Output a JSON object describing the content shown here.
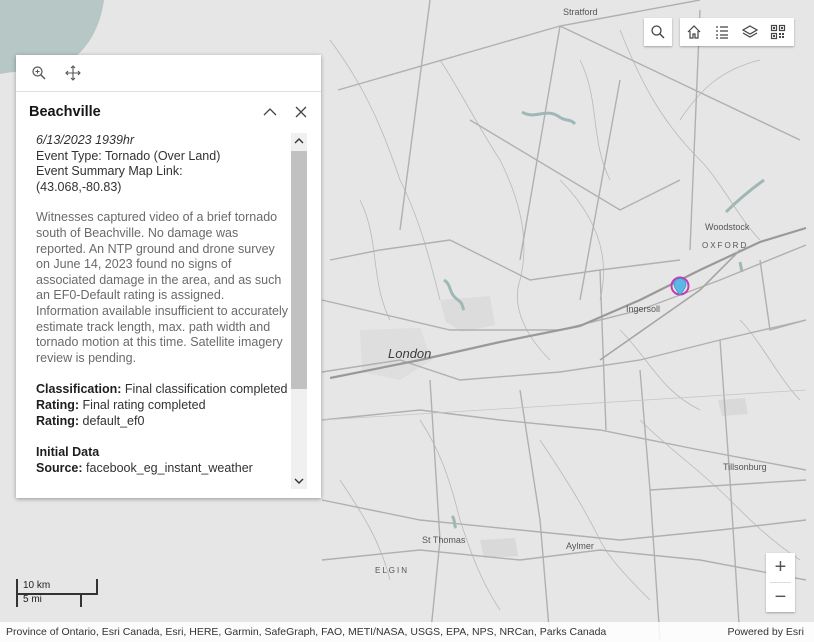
{
  "map": {
    "place_labels": {
      "stratford": "Stratford",
      "woodstock": "Woodstock",
      "oxford": "OXFORD",
      "ingersoll": "Ingersoll",
      "london": "London",
      "tillsonburg": "Tillsonburg",
      "st_thomas": "St Thomas",
      "aylmer": "Aylmer",
      "elgin": "ELGIN"
    },
    "water_color": "#b6c7c6",
    "land_color": "#e6e6e6",
    "road_color": "#b5b5b5"
  },
  "toolbar": {
    "icons": [
      "search-icon",
      "home-icon",
      "legend-icon",
      "layers-icon",
      "qr-code-icon"
    ]
  },
  "popup": {
    "action_icons": [
      "zoom-to-icon",
      "pan-icon"
    ],
    "title": "Beachville",
    "date": "6/13/2023 1939hr",
    "event_type": "Event Type: Tornado (Over Land)",
    "map_link_label": "Event Summary Map Link:",
    "coords": "(43.068,-80.83)",
    "description": "Witnesses captured video of a brief tornado south of Beachville. No damage was reported. An NTP ground and drone survey on June 14, 2023 found no signs of associated damage in the area, and as such an EF0-Default rating is assigned. Information available insufficient to accurately estimate track length, max. path width and tornado motion at this time. Satellite imagery review is pending.",
    "classification_label": "Classification:",
    "classification_value": "Final classification completed",
    "rating_text_label": "Rating:",
    "rating_text_value": "Final rating completed",
    "rating_label": "Rating:",
    "rating_value": "default_ef0",
    "initial_data_heading": "Initial Data",
    "source_label": "Source:",
    "source_value": "facebook_eg_instant_weather"
  },
  "marker": {
    "color": "#5bb8e6",
    "ring_color": "#c23bb4"
  },
  "scalebar": {
    "metric": "10 km",
    "imperial": "5 mi"
  },
  "zoom": {
    "in": "+",
    "out": "−"
  },
  "attribution": {
    "sources": "Province of Ontario, Esri Canada, Esri, HERE, Garmin, SafeGraph, FAO, METI/NASA, USGS, EPA, NPS, NRCan, Parks Canada",
    "powered_by": "Powered by Esri"
  }
}
